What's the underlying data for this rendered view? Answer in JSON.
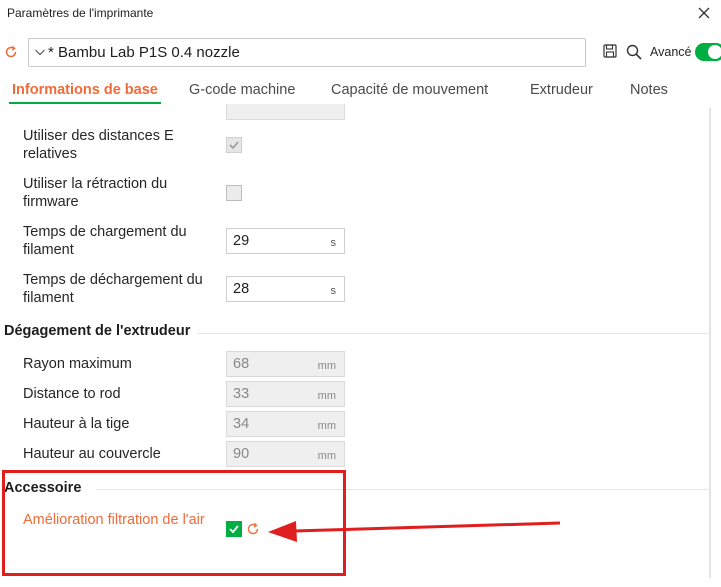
{
  "window": {
    "title": "Paramètres de l'imprimante"
  },
  "preset": {
    "name": "* Bambu Lab P1S 0.4 nozzle",
    "advanced_label": "Avancé",
    "advanced_on": true
  },
  "tabs": [
    {
      "label": "Informations de base",
      "active": true
    },
    {
      "label": "G-code machine",
      "active": false
    },
    {
      "label": "Capacité de mouvement",
      "active": false
    },
    {
      "label": "Extrudeur",
      "active": false
    },
    {
      "label": "Notes",
      "active": false
    }
  ],
  "rows": {
    "relative_e": {
      "label": "Utiliser des distances E relatives",
      "checked": true,
      "disabled": true
    },
    "firmware_retraction": {
      "label": "Utiliser la rétraction du firmware",
      "checked": false
    },
    "load_time": {
      "label": "Temps de chargement du filament",
      "value": "29",
      "unit": "s"
    },
    "unload_time": {
      "label": "Temps de déchargement du filament",
      "value": "28",
      "unit": "s"
    }
  },
  "extruder_clearance": {
    "title": "Dégagement de l'extrudeur",
    "radius": {
      "label": "Rayon maximum",
      "value": "68",
      "unit": "mm"
    },
    "distance_rod": {
      "label": "Distance to rod",
      "value": "33",
      "unit": "mm"
    },
    "height_rod": {
      "label": "Hauteur à la tige",
      "value": "34",
      "unit": "mm"
    },
    "height_lid": {
      "label": "Hauteur au couvercle",
      "value": "90",
      "unit": "mm"
    }
  },
  "accessory": {
    "title": "Accessoire",
    "air_filtration": {
      "label": "Amélioration filtration de l'air",
      "checked": true
    }
  },
  "colors": {
    "accent": "#00ae42",
    "modified": "#ef6b39",
    "annotation": "#e01e1e"
  }
}
